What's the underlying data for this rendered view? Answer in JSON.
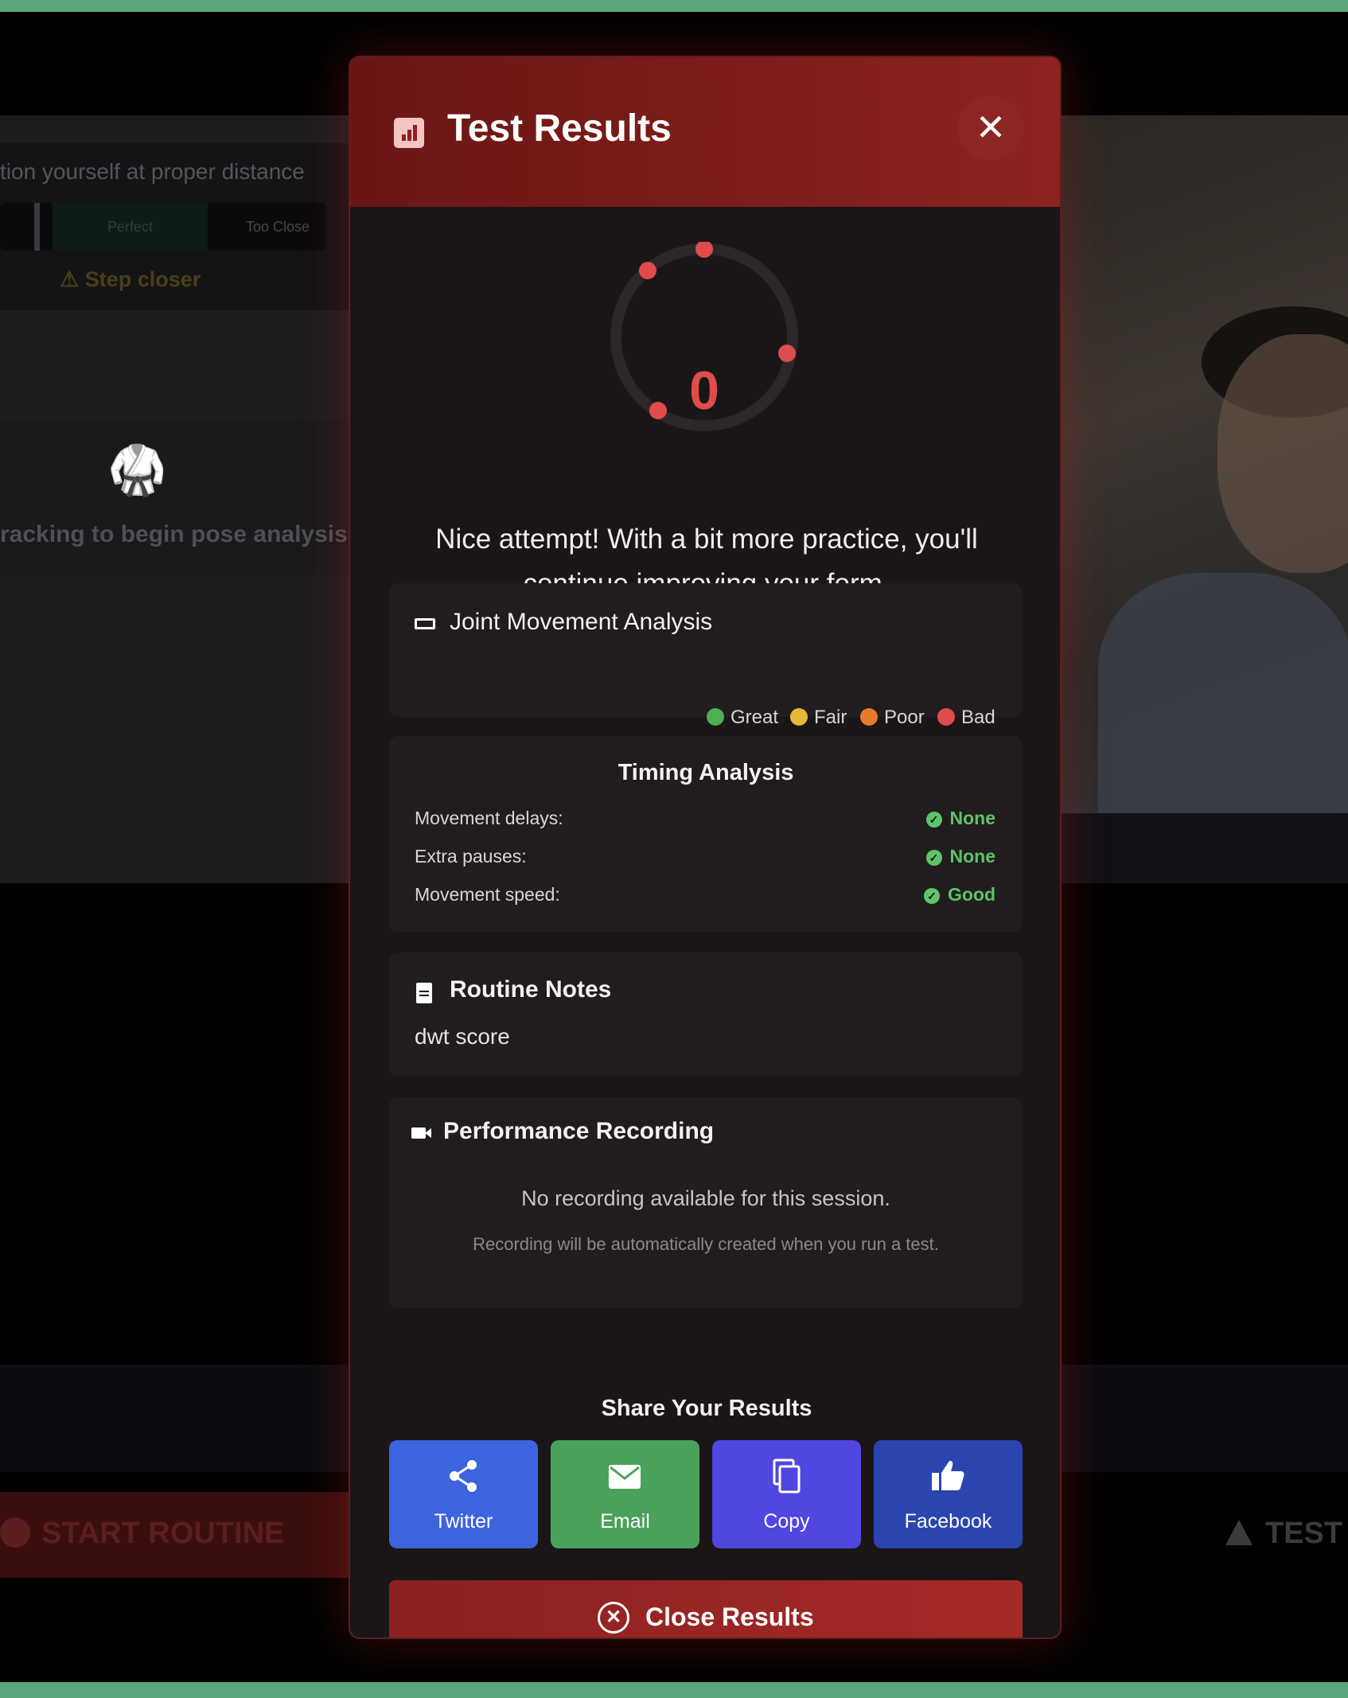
{
  "background": {
    "guide_text": "tion yourself at proper distance",
    "distance_perfect": "Perfect",
    "distance_too_close": "Too Close",
    "step_hint": "⚠ Step closer",
    "tracking_text": "racking to begin pose analysis",
    "start_routine": "START ROUTINE",
    "test": "TEST"
  },
  "modal": {
    "title": "Test Results",
    "score": "0",
    "message": "Nice attempt! With a bit more practice, you'll continue improving your form.",
    "joint_analysis": {
      "title": "Joint Movement Analysis",
      "legend": [
        {
          "label": "Great",
          "color": "#4caf50"
        },
        {
          "label": "Fair",
          "color": "#e6b93a"
        },
        {
          "label": "Poor",
          "color": "#e87a2e"
        },
        {
          "label": "Bad",
          "color": "#e04b4b"
        }
      ]
    },
    "timing": {
      "title": "Timing Analysis",
      "rows": [
        {
          "label": "Movement delays:",
          "value": "None"
        },
        {
          "label": "Extra pauses:",
          "value": "None"
        },
        {
          "label": "Movement speed:",
          "value": "Good"
        }
      ]
    },
    "notes": {
      "title": "Routine Notes",
      "text": "dwt score"
    },
    "recording": {
      "title": "Performance Recording",
      "empty": "No recording available for this session.",
      "hint": "Recording will be automatically created when you run a test."
    },
    "share": {
      "title": "Share Your Results",
      "buttons": [
        {
          "label": "Twitter",
          "color": "#3d63dd",
          "icon": "share-icon"
        },
        {
          "label": "Email",
          "color": "#4aa25a",
          "icon": "email-icon"
        },
        {
          "label": "Copy",
          "color": "#5046e0",
          "icon": "copy-icon"
        },
        {
          "label": "Facebook",
          "color": "#2a45b0",
          "icon": "thumbs-up-icon"
        }
      ]
    },
    "close_label": "Close Results"
  }
}
